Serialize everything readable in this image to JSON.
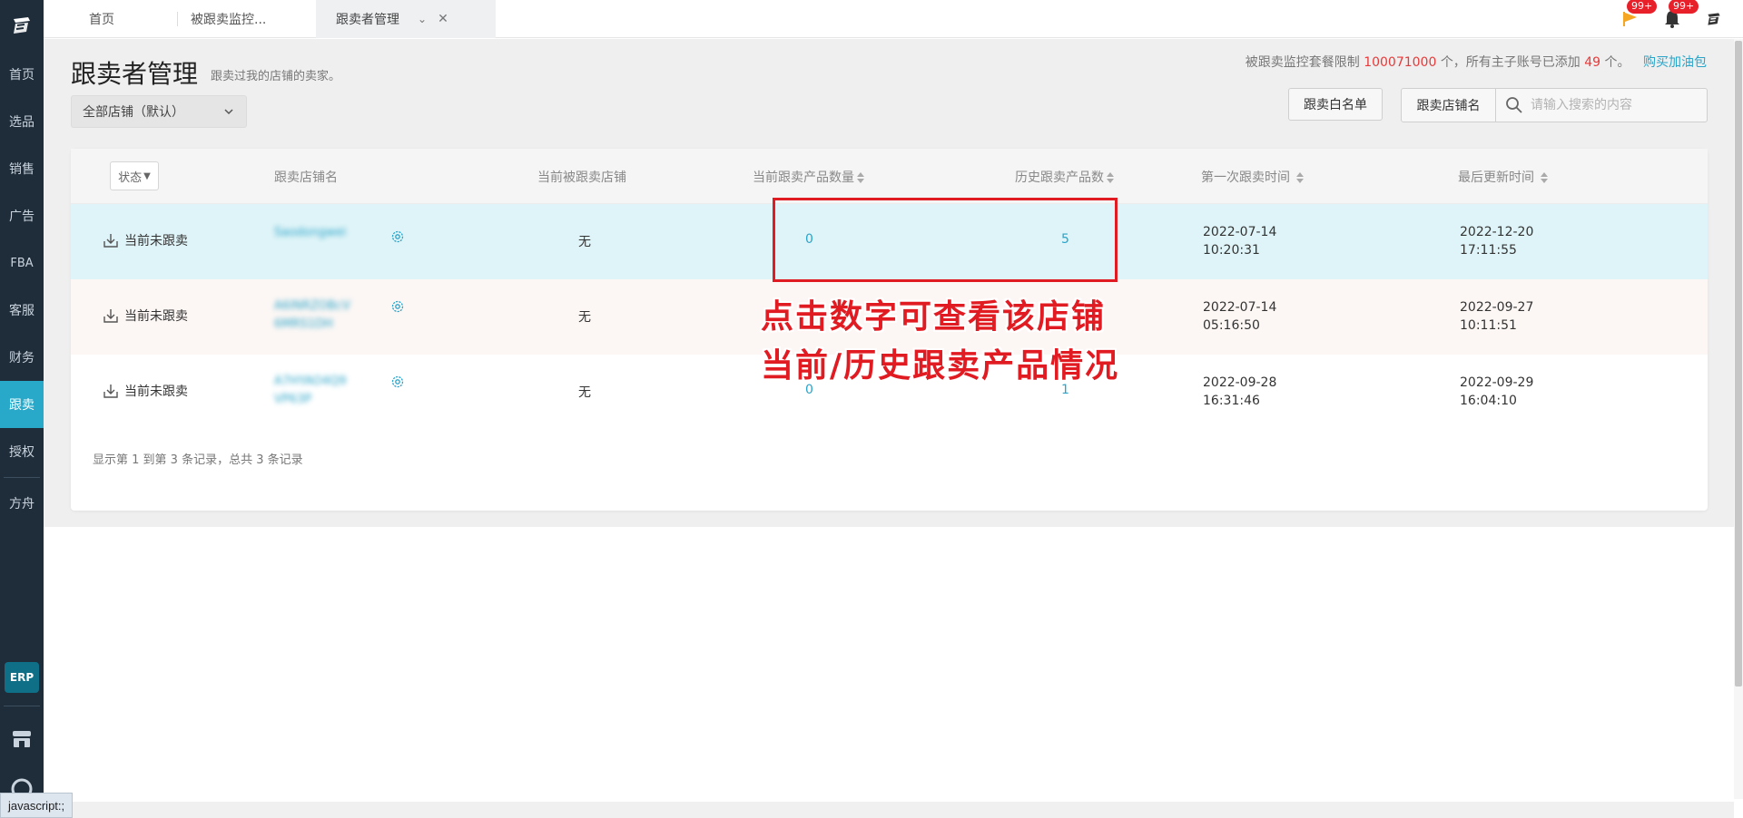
{
  "sidebar": {
    "items": [
      {
        "label": "首页"
      },
      {
        "label": "选品"
      },
      {
        "label": "销售"
      },
      {
        "label": "广告"
      },
      {
        "label": "FBA"
      },
      {
        "label": "客服"
      },
      {
        "label": "财务"
      },
      {
        "label": "跟卖",
        "active": true
      },
      {
        "label": "授权"
      },
      {
        "label": "方舟"
      }
    ],
    "erp_label": "ERP"
  },
  "tabs": [
    {
      "label": "首页"
    },
    {
      "label": "被跟卖监控..."
    },
    {
      "label": "跟卖者管理",
      "active": true
    }
  ],
  "top_icons": {
    "flag_badge": "99+",
    "bell_badge": "99+"
  },
  "page": {
    "title": "跟卖者管理",
    "subtitle": "跟卖过我的店铺的卖家。",
    "limit_prefix": "被跟卖监控套餐限制",
    "limit_value": "100071000",
    "limit_mid": "个，所有主子账号已添加",
    "added_value": "49",
    "limit_suffix": "个。",
    "buy_link": "购买加油包",
    "shop_select": "全部店铺（默认）",
    "whitelist_button": "跟卖白名单",
    "search_scope": "跟卖店铺名",
    "search_placeholder": "请输入搜索的内容"
  },
  "table": {
    "headers": {
      "status": "状态",
      "shop_name": "跟卖店铺名",
      "monitored_shop": "当前被跟卖店铺",
      "current_count": "当前跟卖产品数量",
      "history_count": "历史跟卖产品数",
      "first_time": "第一次跟卖时间",
      "last_update": "最后更新时间"
    },
    "rows": [
      {
        "status": "当前未跟卖",
        "shop_name": "Saodongwei",
        "monitored": "无",
        "current": "0",
        "history": "5",
        "first_date": "2022-07-14",
        "first_time": "10:20:31",
        "last_date": "2022-12-20",
        "last_time": "17:11:55"
      },
      {
        "status": "当前未跟卖",
        "shop_name": "A6INRZOBcV6MRS1DH",
        "monitored": "无",
        "current": "",
        "history": "",
        "first_date": "2022-07-14",
        "first_time": "05:16:50",
        "last_date": "2022-09-27",
        "last_time": "10:11:51"
      },
      {
        "status": "当前未跟卖",
        "shop_name": "A7HYAO4Q9VP63P",
        "monitored": "无",
        "current": "0",
        "history": "1",
        "first_date": "2022-09-28",
        "first_time": "16:31:46",
        "last_date": "2022-09-29",
        "last_time": "16:04:10"
      }
    ],
    "footer": "显示第 1 到第 3 条记录，总共 3 条记录"
  },
  "annotation": {
    "line1": "点击数字可查看该店铺",
    "line2": "当前/历史跟卖产品情况"
  },
  "browser_status": "javascript:;",
  "colors": {
    "sidebar_bg": "#1f2d3a",
    "accent": "#29a9c9",
    "annotation_red": "#e11b22",
    "limit_red": "#e63a3a"
  }
}
